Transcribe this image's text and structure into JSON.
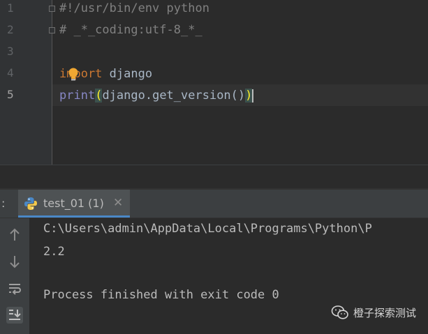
{
  "editor": {
    "line_numbers": [
      "1",
      "2",
      "3",
      "4",
      "5"
    ],
    "line1": "#!/usr/bin/env python",
    "line2": "# _*_coding:utf-8_*_",
    "line4_kw": "import",
    "line4_rest": " django",
    "line5_print": "print",
    "line5_open": "(",
    "line5_rest": "django.get_version()",
    "line5_close": ")"
  },
  "run_panel": {
    "colon": ":",
    "tab_label": "test_01 (1)",
    "close_symbol": "✕"
  },
  "side_toolbar": {
    "icons": [
      "arrow-up-icon",
      "arrow-down-icon",
      "soft-wrap-icon",
      "scroll-to-end-icon"
    ]
  },
  "console": {
    "line1": "C:\\Users\\admin\\AppData\\Local\\Programs\\Python\\P",
    "line2": "2.2",
    "line3": "Process finished with exit code 0"
  },
  "watermark": {
    "text": "橙子探索测试"
  },
  "colors": {
    "background": "#2b2b2b",
    "keyword": "#cc7832",
    "builtin": "#8888c6",
    "comment": "#808080",
    "text": "#a9b7c6",
    "active_tab_underline": "#4a88c7"
  }
}
